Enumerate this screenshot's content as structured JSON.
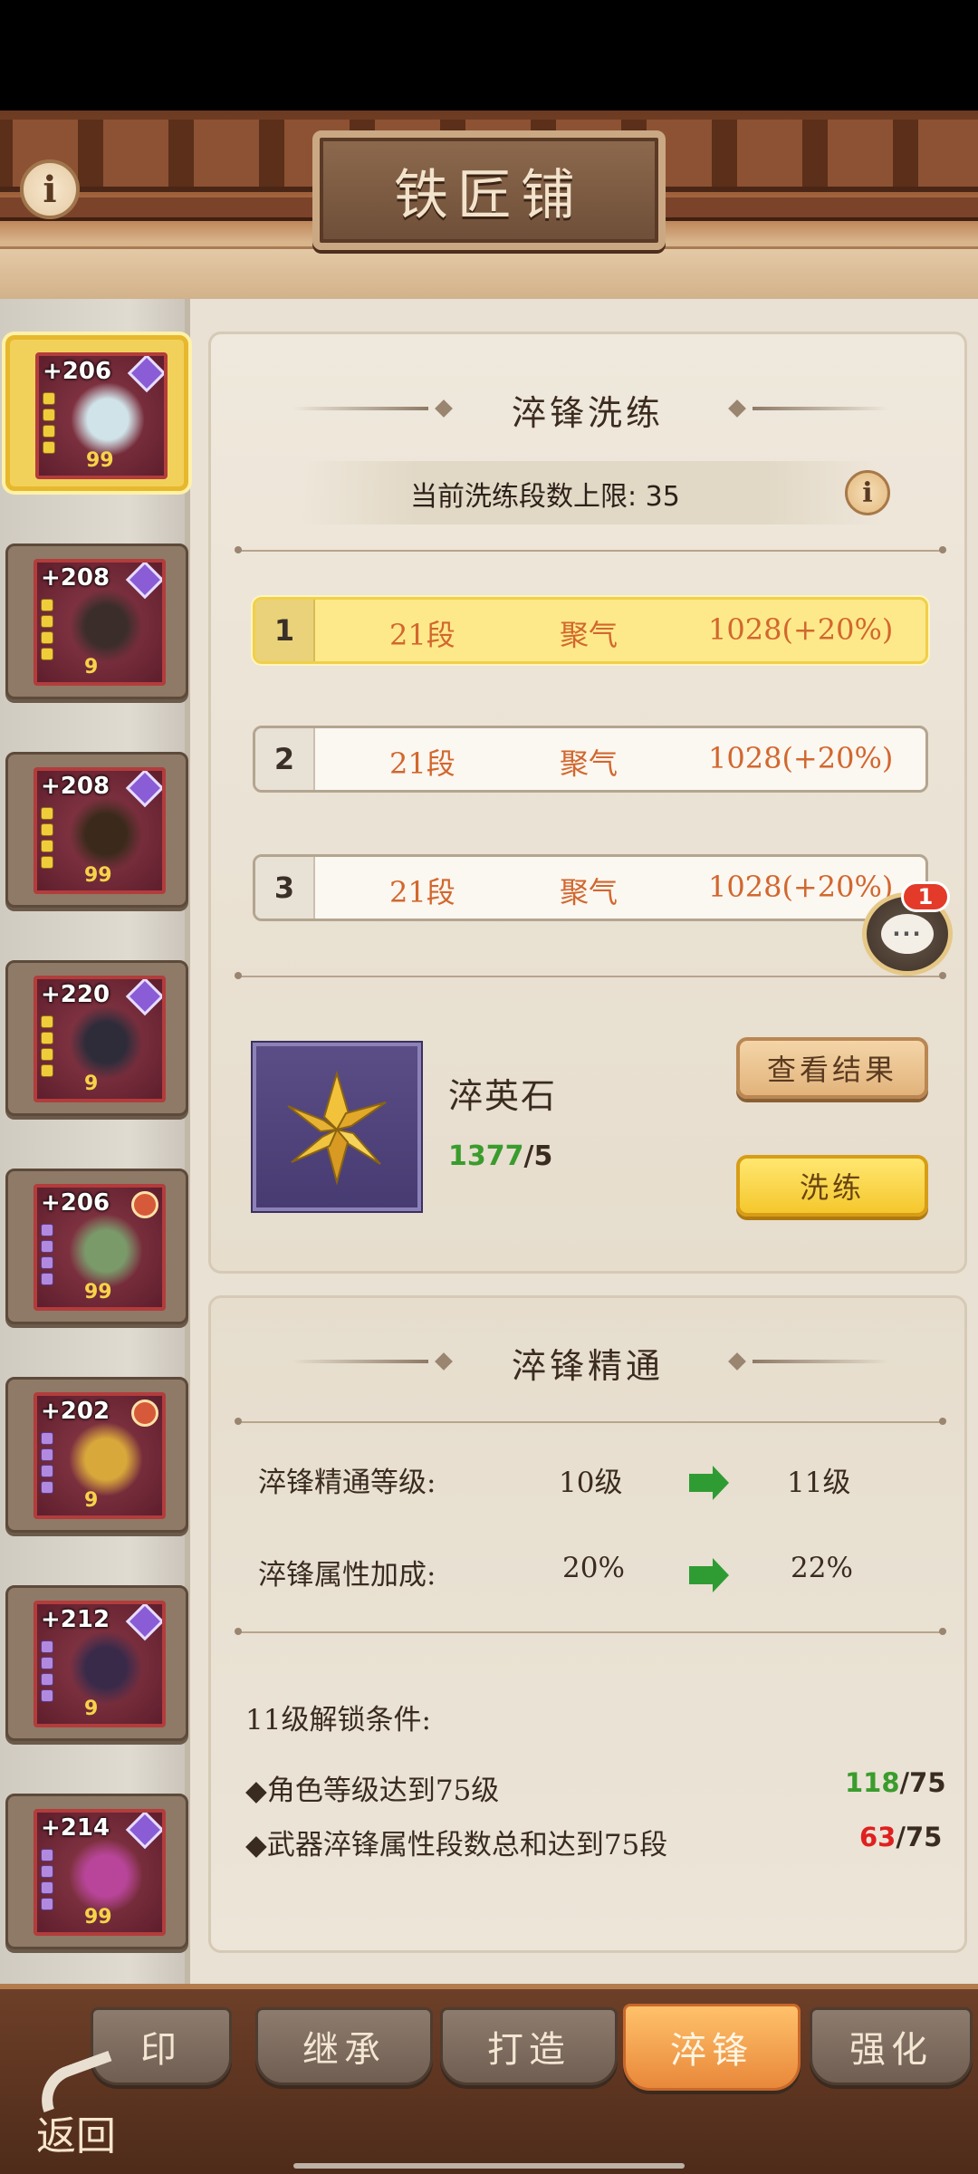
{
  "header": {
    "title": "铁匠铺",
    "info_icon": "i"
  },
  "equipment": [
    {
      "level": "+206",
      "gem": "purple",
      "dots": "gold",
      "stars": "99",
      "name": "fan"
    },
    {
      "level": "+208",
      "gem": "purple",
      "dots": "gold",
      "stars": "9",
      "name": "robe"
    },
    {
      "level": "+208",
      "gem": "purple",
      "dots": "gold",
      "stars": "99",
      "name": "belt"
    },
    {
      "level": "+220",
      "gem": "purple",
      "dots": "gold",
      "stars": "9",
      "name": "boots"
    },
    {
      "level": "+206",
      "gem": "orange",
      "dots": "purple",
      "stars": "99",
      "name": "necklace"
    },
    {
      "level": "+202",
      "gem": "orange",
      "dots": "purple",
      "stars": "9",
      "name": "hairpin"
    },
    {
      "level": "+212",
      "gem": "purple",
      "dots": "purple",
      "stars": "9",
      "name": "bracelet"
    },
    {
      "level": "+214",
      "gem": "purple",
      "dots": "purple",
      "stars": "99",
      "name": "ring"
    }
  ],
  "refine": {
    "title": "淬锋洗练",
    "limit_text": "当前洗练段数上限: 35",
    "rows": [
      {
        "num": "1",
        "segment": "21段",
        "attr": "聚气",
        "value": "1028(+20%)"
      },
      {
        "num": "2",
        "segment": "21段",
        "attr": "聚气",
        "value": "1028(+20%)"
      },
      {
        "num": "3",
        "segment": "21段",
        "attr": "聚气",
        "value": "1028(+20%)"
      }
    ],
    "material_name": "淬英石",
    "material_have": "1377",
    "material_need": "/5",
    "view_result_label": "查看结果",
    "refine_label": "洗练"
  },
  "chat": {
    "badge": "1",
    "glyph": "···"
  },
  "mastery": {
    "title": "淬锋精通",
    "level_label": "淬锋精通等级:",
    "level_from": "10级",
    "level_to": "11级",
    "bonus_label": "淬锋属性加成:",
    "bonus_from": "20%",
    "bonus_to": "22%",
    "unlock_title": "11级解锁条件:",
    "conditions": [
      {
        "text": "◆角色等级达到75级",
        "have": "118",
        "need": "/75",
        "met": true
      },
      {
        "text": "◆武器淬锋属性段数总和达到75段",
        "have": "63",
        "need": "/75",
        "met": false
      }
    ]
  },
  "tabs": [
    {
      "label": "印",
      "active": false
    },
    {
      "label": "继承",
      "active": false
    },
    {
      "label": "打造",
      "active": false
    },
    {
      "label": "淬锋",
      "active": true
    },
    {
      "label": "强化",
      "active": false
    }
  ],
  "back_label": "返回",
  "colors": {
    "accent": "#f5c72d",
    "met": "#3a9c2c",
    "unmet": "#e02020"
  }
}
